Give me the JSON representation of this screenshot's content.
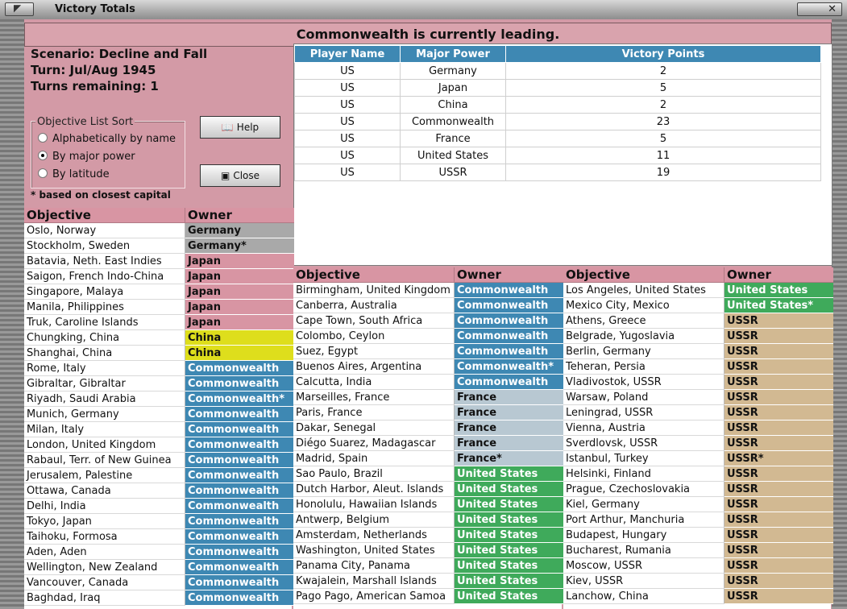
{
  "window": {
    "title": "Victory Totals"
  },
  "banner": "Commonwealth is currently leading.",
  "info": {
    "scenario": "Scenario: Decline and Fall",
    "turn": "Turn: Jul/Aug 1945",
    "remaining": "Turns remaining: 1"
  },
  "sort": {
    "legend": "Objective List Sort",
    "options": [
      "Alphabetically by name",
      "By major power",
      "By latitude"
    ],
    "selected": "By major power"
  },
  "buttons": {
    "help": "Help",
    "close": "Close"
  },
  "note": "* based on closest capital",
  "power_colors": {
    "Germany": "#a9a9a9",
    "Japan": "#d895a3",
    "China": "#dede1c",
    "Commonwealth": "#3e88b3",
    "France": "#b8c8d2",
    "United States": "#3faa5b",
    "USSR": "#d2b992"
  },
  "vp_table": {
    "headers": [
      "Player Name",
      "Major Power",
      "Victory Points"
    ],
    "rows": [
      [
        "US",
        "Germany",
        "2"
      ],
      [
        "US",
        "Japan",
        "5"
      ],
      [
        "US",
        "China",
        "2"
      ],
      [
        "US",
        "Commonwealth",
        "23"
      ],
      [
        "US",
        "France",
        "5"
      ],
      [
        "US",
        "United States",
        "11"
      ],
      [
        "US",
        "USSR",
        "19"
      ]
    ]
  },
  "objective_headers": {
    "objective": "Objective",
    "owner": "Owner"
  },
  "objectives": {
    "left": [
      [
        "Oslo, Norway",
        "Germany",
        "Germany"
      ],
      [
        "Stockholm, Sweden",
        "Germany*",
        "Germany"
      ],
      [
        "Batavia, Neth. East Indies",
        "Japan",
        "Japan"
      ],
      [
        "Saigon, French Indo-China",
        "Japan",
        "Japan"
      ],
      [
        "Singapore, Malaya",
        "Japan",
        "Japan"
      ],
      [
        "Manila, Philippines",
        "Japan",
        "Japan"
      ],
      [
        "Truk, Caroline Islands",
        "Japan",
        "Japan"
      ],
      [
        "Chungking, China",
        "China",
        "China"
      ],
      [
        "Shanghai, China",
        "China",
        "China"
      ],
      [
        "Rome, Italy",
        "Commonwealth",
        "Commonwealth"
      ],
      [
        "Gibraltar, Gibraltar",
        "Commonwealth",
        "Commonwealth"
      ],
      [
        "Riyadh, Saudi Arabia",
        "Commonwealth*",
        "Commonwealth"
      ],
      [
        "Munich, Germany",
        "Commonwealth",
        "Commonwealth"
      ],
      [
        "Milan, Italy",
        "Commonwealth",
        "Commonwealth"
      ],
      [
        "London, United Kingdom",
        "Commonwealth",
        "Commonwealth"
      ],
      [
        "Rabaul, Terr. of New Guinea",
        "Commonwealth",
        "Commonwealth"
      ],
      [
        "Jerusalem, Palestine",
        "Commonwealth",
        "Commonwealth"
      ],
      [
        "Ottawa, Canada",
        "Commonwealth",
        "Commonwealth"
      ],
      [
        "Delhi, India",
        "Commonwealth",
        "Commonwealth"
      ],
      [
        "Tokyo, Japan",
        "Commonwealth",
        "Commonwealth"
      ],
      [
        "Taihoku, Formosa",
        "Commonwealth",
        "Commonwealth"
      ],
      [
        "Aden, Aden",
        "Commonwealth",
        "Commonwealth"
      ],
      [
        "Wellington, New Zealand",
        "Commonwealth",
        "Commonwealth"
      ],
      [
        "Vancouver, Canada",
        "Commonwealth",
        "Commonwealth"
      ],
      [
        "Baghdad, Iraq",
        "Commonwealth",
        "Commonwealth"
      ]
    ],
    "middle": [
      [
        "Birmingham, United Kingdom",
        "Commonwealth",
        "Commonwealth"
      ],
      [
        "Canberra, Australia",
        "Commonwealth",
        "Commonwealth"
      ],
      [
        "Cape Town, South Africa",
        "Commonwealth",
        "Commonwealth"
      ],
      [
        "Colombo, Ceylon",
        "Commonwealth",
        "Commonwealth"
      ],
      [
        "Suez, Egypt",
        "Commonwealth",
        "Commonwealth"
      ],
      [
        "Buenos Aires, Argentina",
        "Commonwealth*",
        "Commonwealth"
      ],
      [
        "Calcutta, India",
        "Commonwealth",
        "Commonwealth"
      ],
      [
        "Marseilles, France",
        "France",
        "France"
      ],
      [
        "Paris, France",
        "France",
        "France"
      ],
      [
        "Dakar, Senegal",
        "France",
        "France"
      ],
      [
        "Diégo Suarez, Madagascar",
        "France",
        "France"
      ],
      [
        "Madrid, Spain",
        "France*",
        "France"
      ],
      [
        "Sao Paulo, Brazil",
        "United States",
        "United States"
      ],
      [
        "Dutch Harbor, Aleut. Islands",
        "United States",
        "United States"
      ],
      [
        "Honolulu, Hawaiian Islands",
        "United States",
        "United States"
      ],
      [
        "Antwerp, Belgium",
        "United States",
        "United States"
      ],
      [
        "Amsterdam, Netherlands",
        "United States",
        "United States"
      ],
      [
        "Washington, United States",
        "United States",
        "United States"
      ],
      [
        "Panama City, Panama",
        "United States",
        "United States"
      ],
      [
        "Kwajalein, Marshall Islands",
        "United States",
        "United States"
      ],
      [
        "Pago Pago, American Samoa",
        "United States",
        "United States"
      ]
    ],
    "right": [
      [
        "Los Angeles, United States",
        "United States",
        "United States"
      ],
      [
        "Mexico City, Mexico",
        "United States*",
        "United States"
      ],
      [
        "Athens, Greece",
        "USSR",
        "USSR"
      ],
      [
        "Belgrade, Yugoslavia",
        "USSR",
        "USSR"
      ],
      [
        "Berlin, Germany",
        "USSR",
        "USSR"
      ],
      [
        "Teheran, Persia",
        "USSR",
        "USSR"
      ],
      [
        "Vladivostok, USSR",
        "USSR",
        "USSR"
      ],
      [
        "Warsaw, Poland",
        "USSR",
        "USSR"
      ],
      [
        "Leningrad, USSR",
        "USSR",
        "USSR"
      ],
      [
        "Vienna, Austria",
        "USSR",
        "USSR"
      ],
      [
        "Sverdlovsk, USSR",
        "USSR",
        "USSR"
      ],
      [
        "Istanbul, Turkey",
        "USSR*",
        "USSR"
      ],
      [
        "Helsinki, Finland",
        "USSR",
        "USSR"
      ],
      [
        "Prague, Czechoslovakia",
        "USSR",
        "USSR"
      ],
      [
        "Kiel, Germany",
        "USSR",
        "USSR"
      ],
      [
        "Port Arthur, Manchuria",
        "USSR",
        "USSR"
      ],
      [
        "Budapest, Hungary",
        "USSR",
        "USSR"
      ],
      [
        "Bucharest, Rumania",
        "USSR",
        "USSR"
      ],
      [
        "Moscow, USSR",
        "USSR",
        "USSR"
      ],
      [
        "Kiev, USSR",
        "USSR",
        "USSR"
      ],
      [
        "Lanchow, China",
        "USSR",
        "USSR"
      ]
    ]
  }
}
